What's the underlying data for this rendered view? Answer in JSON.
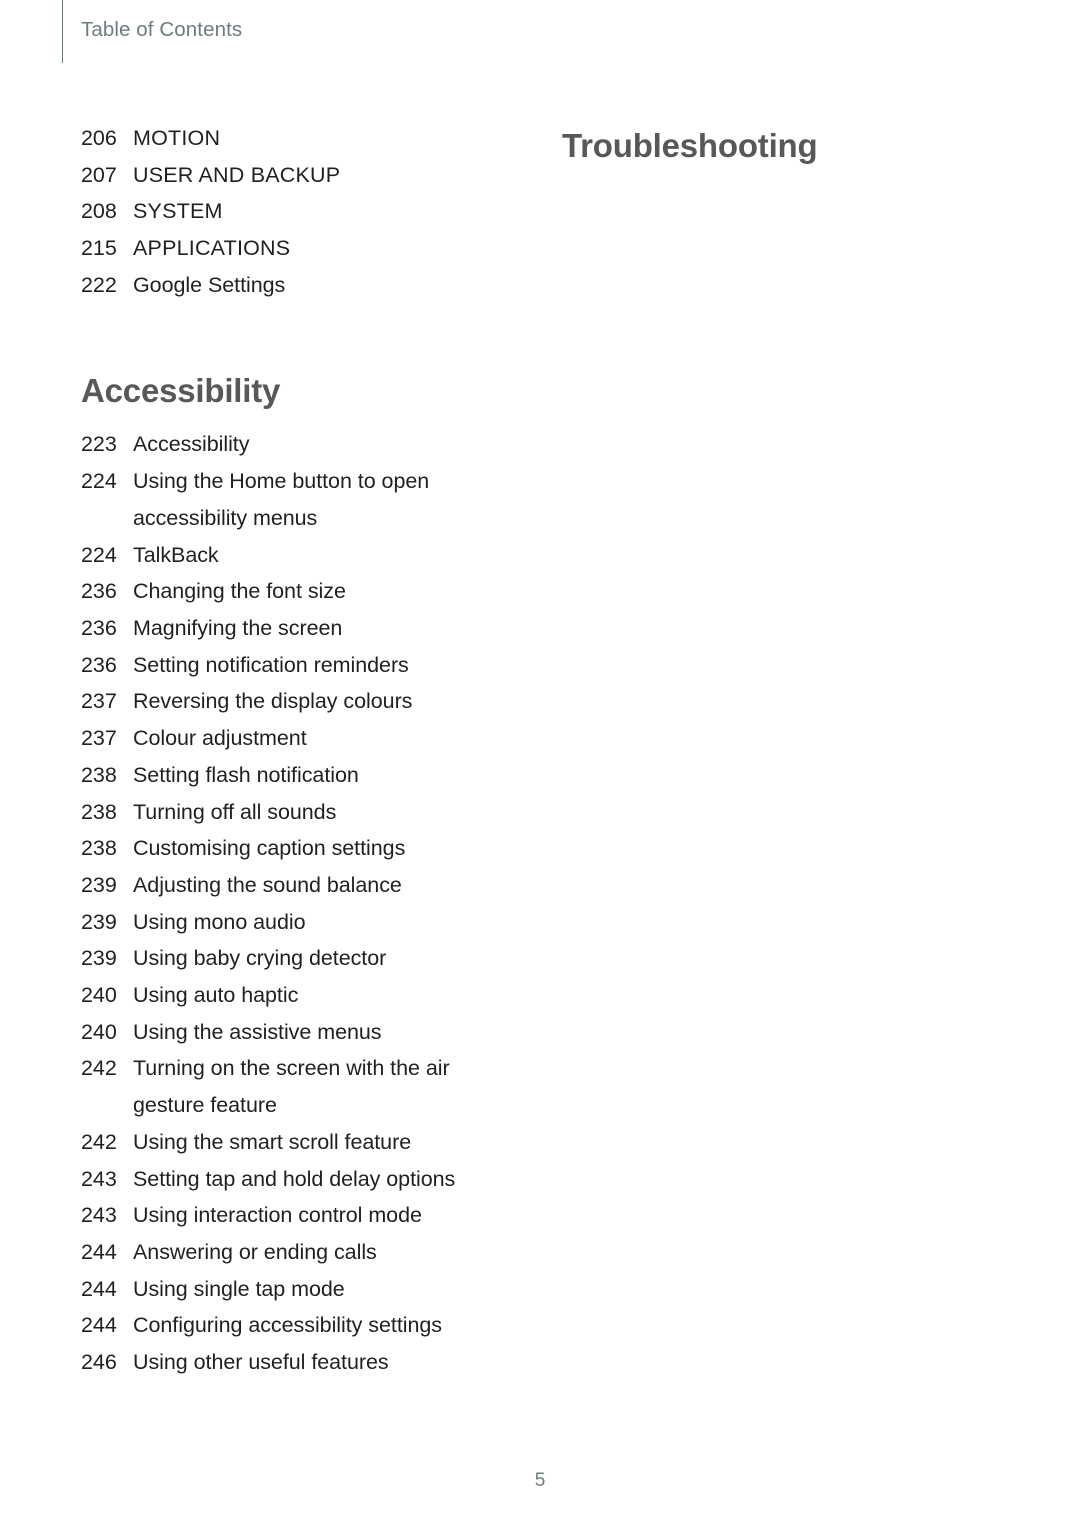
{
  "header": {
    "running_title": "Table of Contents"
  },
  "left_column": {
    "top_entries": [
      {
        "page": "206",
        "title": "MOTION",
        "style": "uppercase"
      },
      {
        "page": "207",
        "title": "USER AND BACKUP",
        "style": "uppercase"
      },
      {
        "page": "208",
        "title": "SYSTEM",
        "style": "uppercase"
      },
      {
        "page": "215",
        "title": "APPLICATIONS",
        "style": "uppercase"
      },
      {
        "page": "222",
        "title": "Google Settings",
        "style": "normal"
      }
    ],
    "section_heading": "Accessibility",
    "section_entries": [
      {
        "page": "223",
        "title": "Accessibility"
      },
      {
        "page": "224",
        "title": "Using the Home button to open accessibility menus"
      },
      {
        "page": "224",
        "title": "TalkBack"
      },
      {
        "page": "236",
        "title": "Changing the font size"
      },
      {
        "page": "236",
        "title": "Magnifying the screen"
      },
      {
        "page": "236",
        "title": "Setting notification reminders"
      },
      {
        "page": "237",
        "title": "Reversing the display colours"
      },
      {
        "page": "237",
        "title": "Colour adjustment"
      },
      {
        "page": "238",
        "title": "Setting flash notification"
      },
      {
        "page": "238",
        "title": "Turning off all sounds"
      },
      {
        "page": "238",
        "title": "Customising caption settings"
      },
      {
        "page": "239",
        "title": "Adjusting the sound balance"
      },
      {
        "page": "239",
        "title": "Using mono audio"
      },
      {
        "page": "239",
        "title": "Using baby crying detector"
      },
      {
        "page": "240",
        "title": "Using auto haptic"
      },
      {
        "page": "240",
        "title": "Using the assistive menus"
      },
      {
        "page": "242",
        "title": "Turning on the screen with the air gesture feature"
      },
      {
        "page": "242",
        "title": "Using the smart scroll feature"
      },
      {
        "page": "243",
        "title": "Setting tap and hold delay options"
      },
      {
        "page": "243",
        "title": "Using interaction control mode"
      },
      {
        "page": "244",
        "title": "Answering or ending calls"
      },
      {
        "page": "244",
        "title": "Using single tap mode"
      },
      {
        "page": "244",
        "title": "Configuring accessibility settings"
      },
      {
        "page": "246",
        "title": "Using other useful features"
      }
    ]
  },
  "right_column": {
    "section_heading": "Troubleshooting"
  },
  "footer": {
    "page_number": "5"
  },
  "colors": {
    "header_grey": "#6e7c80",
    "heading_grey": "#58585a",
    "body_black": "#231f20",
    "background": "#ffffff"
  }
}
